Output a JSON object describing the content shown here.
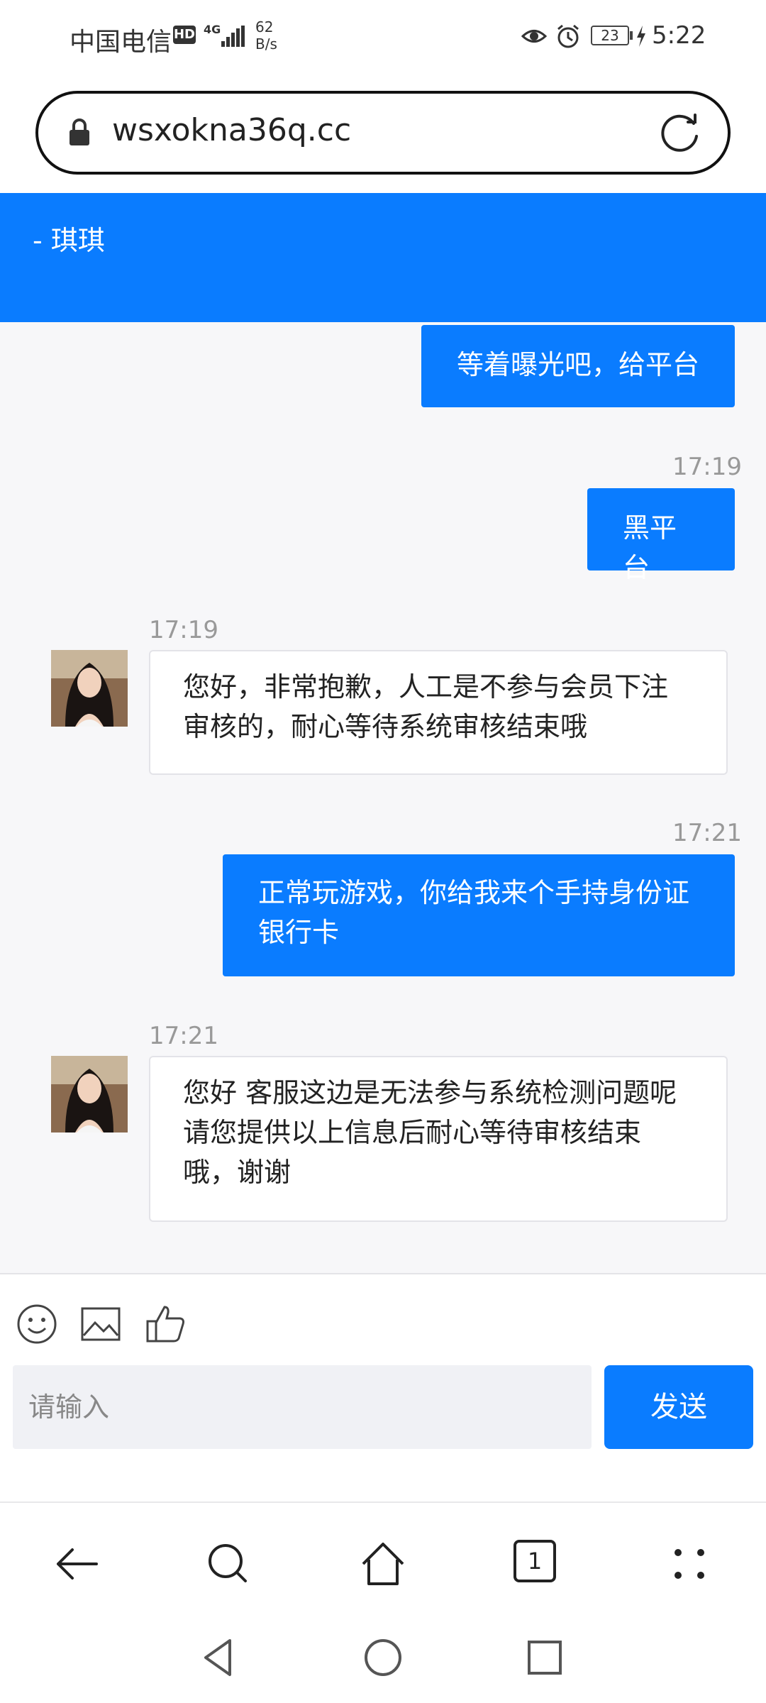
{
  "status_bar": {
    "carrier": "中国电信",
    "hd": "HD",
    "network": "4G",
    "speed_value": "62",
    "speed_unit": "B/s",
    "battery": "23",
    "time": "5:22"
  },
  "browser": {
    "url": "wsxokna36q.cc"
  },
  "chat": {
    "title": "- 琪琪",
    "messages": [
      {
        "side": "out",
        "time": "",
        "text": "等着曝光吧，给平台"
      },
      {
        "side": "out",
        "time": "17:19",
        "text": "黑平台"
      },
      {
        "side": "in",
        "time": "17:19",
        "lines": [
          "您好，非常抱歉，人工是不参与会员下注",
          "审核的，耐心等待系统审核结束哦"
        ]
      },
      {
        "side": "out",
        "time": "17:21",
        "lines": [
          "正常玩游戏，你给我来个手持身份证",
          "银行卡"
        ]
      },
      {
        "side": "in",
        "time": "17:21",
        "lines": [
          "您好 客服这边是无法参与系统检测问题呢",
          "请您提供以上信息后耐心等待审核结束",
          "哦，谢谢"
        ]
      }
    ]
  },
  "composer": {
    "placeholder": "请输入",
    "send_label": "发送",
    "tools": [
      "emoji-icon",
      "image-icon",
      "thumbs-up-icon"
    ]
  },
  "browser_nav": {
    "tab_count": "1",
    "icons": [
      "back-arrow-icon",
      "search-icon",
      "home-icon",
      "tabs-icon",
      "menu-dots-icon"
    ]
  },
  "system_nav": {
    "icons": [
      "back-triangle-icon",
      "home-circle-icon",
      "recents-square-icon"
    ]
  },
  "colors": {
    "accent": "#0a7cff",
    "chat_bg": "#f7f7f9"
  }
}
